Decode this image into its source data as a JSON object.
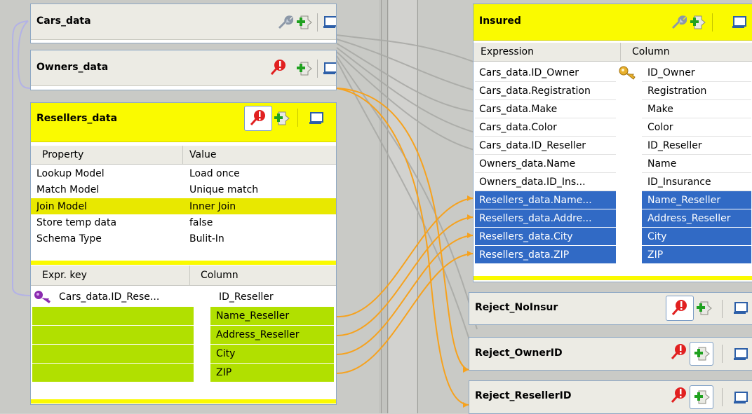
{
  "lookups": {
    "cars": {
      "title": "Cars_data"
    },
    "owners": {
      "title": "Owners_data"
    },
    "resellers": {
      "title": "Resellers_data",
      "property_header": "Property",
      "value_header": "Value",
      "properties": [
        {
          "property": "Lookup Model",
          "value": "Load once"
        },
        {
          "property": "Match Model",
          "value": "Unique match"
        },
        {
          "property": "Join Model",
          "value": "Inner Join"
        },
        {
          "property": "Store temp data",
          "value": "false"
        },
        {
          "property": "Schema Type",
          "value": "Bulit-In"
        }
      ],
      "expr_header": "Expr. key",
      "column_header": "Column",
      "key_row": {
        "expr": "Cars_data.ID_Rese...",
        "column": "ID_Reseller"
      },
      "columns": [
        "Name_Reseller",
        "Address_Reseller",
        "City",
        "ZIP"
      ]
    }
  },
  "outputs": {
    "insured": {
      "title": "Insured",
      "expression_header": "Expression",
      "column_header": "Column",
      "rows": [
        {
          "expr": "Cars_data.ID_Owner",
          "column": "ID_Owner",
          "key": true,
          "selected": false
        },
        {
          "expr": "Cars_data.Registration",
          "column": "Registration",
          "key": false,
          "selected": false
        },
        {
          "expr": "Cars_data.Make",
          "column": "Make",
          "key": false,
          "selected": false
        },
        {
          "expr": "Cars_data.Color",
          "column": "Color",
          "key": false,
          "selected": false
        },
        {
          "expr": "Cars_data.ID_Reseller",
          "column": "ID_Reseller",
          "key": false,
          "selected": false
        },
        {
          "expr": "Owners_data.Name",
          "column": "Name",
          "key": false,
          "selected": false
        },
        {
          "expr": "Owners_data.ID_Ins...",
          "column": "ID_Insurance",
          "key": false,
          "selected": false
        },
        {
          "expr": "Resellers_data.Name...",
          "column": "Name_Reseller",
          "key": false,
          "selected": true
        },
        {
          "expr": "Resellers_data.Addre...",
          "column": "Address_Reseller",
          "key": false,
          "selected": true
        },
        {
          "expr": "Resellers_data.City",
          "column": "City",
          "key": false,
          "selected": true
        },
        {
          "expr": "Resellers_data.ZIP",
          "column": "ZIP",
          "key": false,
          "selected": true
        }
      ]
    },
    "reject_noinsur": {
      "title": "Reject_NoInsur"
    },
    "reject_ownerid": {
      "title": "Reject_OwnerID"
    },
    "reject_resellerid": {
      "title": "Reject_ResellerID"
    }
  },
  "icons": {
    "settings": "wrench-icon",
    "filter": "filter-expression-icon",
    "add": "add-filter-icon",
    "minimize": "minimize-window-icon",
    "key": "key-icon"
  },
  "colors": {
    "header_yellow": "#fafa00",
    "selection_blue": "#316ac5",
    "matched_green": "#b1e000",
    "link_orange": "#f6a21e",
    "link_lavender": "#b3b2e6"
  }
}
